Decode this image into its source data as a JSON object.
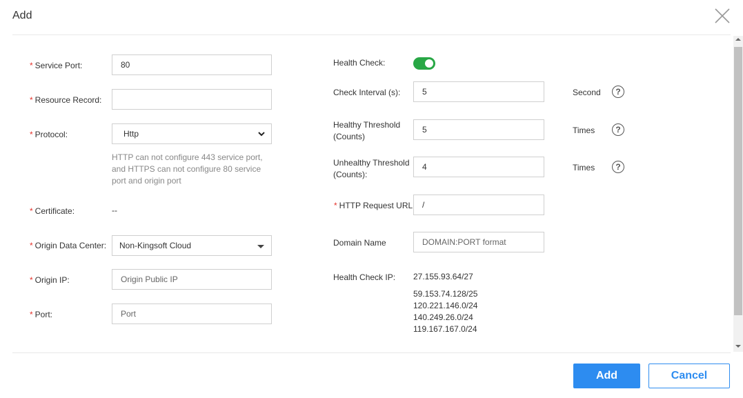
{
  "dialog": {
    "title": "Add"
  },
  "left": {
    "service_port": {
      "label": "Service Port:",
      "value": "80"
    },
    "resource_record": {
      "label": "Resource Record:",
      "value": ""
    },
    "protocol": {
      "label": "Protocol:",
      "value": "Http",
      "hint_lines": [
        "HTTP can not configure 443 service port,",
        "and HTTPS can not configure 80 service",
        "port and origin port"
      ]
    },
    "certificate": {
      "label": "Certificate:",
      "value": "--"
    },
    "origin_dc": {
      "label": "Origin Data Center:",
      "value": "Non-Kingsoft Cloud"
    },
    "origin_ip": {
      "label": "Origin IP:",
      "placeholder": "Origin Public IP"
    },
    "port": {
      "label": "Port:",
      "placeholder": "Port"
    }
  },
  "right": {
    "health_check": {
      "label": "Health Check:",
      "enabled": true
    },
    "check_interval": {
      "label": "Check Interval (s):",
      "value": "5",
      "unit": "Second"
    },
    "healthy_threshold": {
      "label_lines": [
        "Healthy Threshold",
        "(Counts)"
      ],
      "value": "5",
      "unit": "Times"
    },
    "unhealthy_threshold": {
      "label_lines": [
        "Unhealthy Threshold",
        "(Counts):"
      ],
      "value": "4",
      "unit": "Times"
    },
    "http_request_url": {
      "label": "HTTP Request URL",
      "value": "/"
    },
    "domain_name": {
      "label": "Domain Name",
      "placeholder": "DOMAIN:PORT format"
    },
    "health_check_ip": {
      "label": "Health Check IP:",
      "ips": [
        "27.155.93.64/27",
        "59.153.74.128/25",
        "120.221.146.0/24",
        "140.249.26.0/24",
        "119.167.167.0/24"
      ]
    }
  },
  "required_mark": "*",
  "help_glyph": "?",
  "footer": {
    "add_label": "Add",
    "cancel_label": "Cancel"
  },
  "colors": {
    "primary": "#2d8cf0",
    "toggle_on": "#28a745",
    "required": "#e5322b"
  }
}
